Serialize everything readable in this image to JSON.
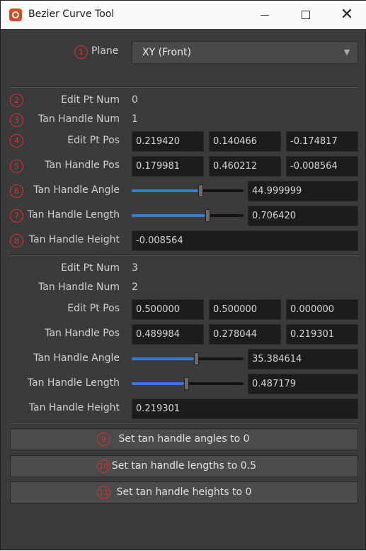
{
  "window": {
    "title": "Bezier Curve Tool"
  },
  "plane": {
    "label": "Plane",
    "value": "XY (Front)"
  },
  "section1": {
    "edit_pt_num": {
      "label": "Edit Pt Num",
      "value": "0"
    },
    "tan_handle_num": {
      "label": "Tan Handle Num",
      "value": "1"
    },
    "edit_pt_pos": {
      "label": "Edit Pt Pos",
      "x": "0.219420",
      "y": "0.140466",
      "z": "-0.174817"
    },
    "tan_handle_pos": {
      "label": "Tan Handle Pos",
      "x": "0.179981",
      "y": "0.460212",
      "z": "-0.008564"
    },
    "tan_handle_angle": {
      "label": "Tan Handle Angle",
      "value": "44.999999",
      "slider_level": 0.62
    },
    "tan_handle_length": {
      "label": "Tan Handle Length",
      "value": "0.706420",
      "slider_level": 0.69
    },
    "tan_handle_height": {
      "label": "Tan Handle Height",
      "value": "-0.008564"
    }
  },
  "section2": {
    "edit_pt_num": {
      "label": "Edit Pt Num",
      "value": "3"
    },
    "tan_handle_num": {
      "label": "Tan Handle Num",
      "value": "2"
    },
    "edit_pt_pos": {
      "label": "Edit Pt Pos",
      "x": "0.500000",
      "y": "0.500000",
      "z": "0.000000"
    },
    "tan_handle_pos": {
      "label": "Tan Handle Pos",
      "x": "0.489984",
      "y": "0.278044",
      "z": "0.219301"
    },
    "tan_handle_angle": {
      "label": "Tan Handle Angle",
      "value": "35.384614",
      "slider_level": 0.58
    },
    "tan_handle_length": {
      "label": "Tan Handle Length",
      "value": "0.487179",
      "slider_level": 0.49
    },
    "tan_handle_height": {
      "label": "Tan Handle Height",
      "value": "0.219301"
    }
  },
  "buttons": {
    "angles": "Set tan handle angles to 0",
    "lengths": "Set tan handle lengths to 0.5",
    "heights": "Set tan handle heights to 0"
  },
  "markers": [
    "1",
    "2",
    "3",
    "4",
    "5",
    "6",
    "7",
    "8",
    "9",
    "10",
    "11"
  ],
  "colors": {
    "accent": "#3a7bd5",
    "marker": "#e0302d",
    "panel": "#3b3b3b",
    "field": "#1c1c1c"
  }
}
